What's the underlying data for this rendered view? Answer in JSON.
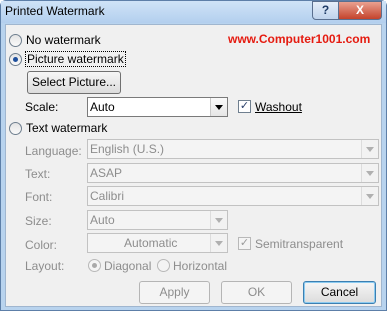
{
  "window": {
    "title": "Printed Watermark",
    "help_glyph": "?",
    "close_glyph": "X"
  },
  "watermark_site": "www.Computer1001.com",
  "options": {
    "no_watermark": "No watermark",
    "picture_watermark": "Picture watermark",
    "text_watermark": "Text watermark",
    "selected": "picture_watermark"
  },
  "picture": {
    "select_button": "Select Picture...",
    "scale_label": "Scale:",
    "scale_value": "Auto",
    "washout_label": "Washout",
    "washout_checked": true
  },
  "text": {
    "language_label": "Language:",
    "language_value": "English (U.S.)",
    "text_label": "Text:",
    "text_value": "ASAP",
    "font_label": "Font:",
    "font_value": "Calibri",
    "size_label": "Size:",
    "size_value": "Auto",
    "color_label": "Color:",
    "color_value": "Automatic",
    "semitransparent_label": "Semitransparent",
    "semitransparent_checked": true,
    "layout_label": "Layout:",
    "layout_diagonal": "Diagonal",
    "layout_horizontal": "Horizontal",
    "layout_selected": "diagonal"
  },
  "buttons": {
    "apply": "Apply",
    "ok": "OK",
    "cancel": "Cancel"
  }
}
